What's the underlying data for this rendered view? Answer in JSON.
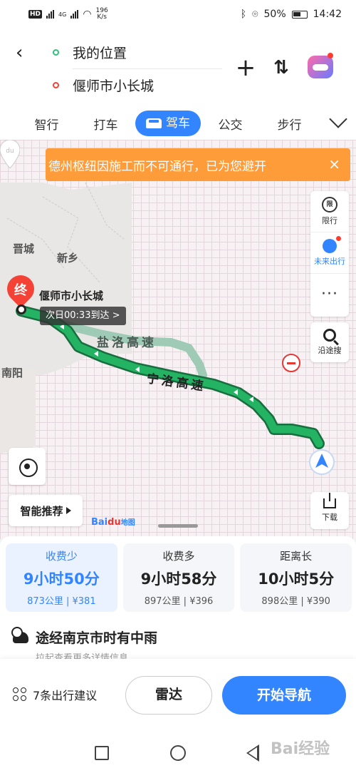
{
  "status_bar": {
    "hd_label": "HD",
    "network_label": "4G",
    "speed_value": "196",
    "speed_unit": "K/s",
    "battery": "50%",
    "time": "14:42"
  },
  "header": {
    "start_point": "我的位置",
    "end_point": "偃师市小长城"
  },
  "tabs": [
    {
      "label": "智行"
    },
    {
      "label": "打车"
    },
    {
      "label": "驾车",
      "active": true
    },
    {
      "label": "公交"
    },
    {
      "label": "步行"
    }
  ],
  "map": {
    "banner_text": "德州枢纽因施工而不可通行，已为您避开",
    "cities": {
      "jincheng": "晋城",
      "xinxiang": "新乡",
      "nanyang": "南阳"
    },
    "end_pin_label": "终",
    "destination_name": "偃师市小长城",
    "eta_text": "次日00:33到达 >",
    "road_alt": "盐洛高速",
    "road_main": "宁洛高速",
    "side_panel": {
      "restrict_icon_text": "限",
      "restrict_label": "限行",
      "future_label": "未来出行",
      "more_label": "···"
    },
    "search_along_label": "沿途搜",
    "smart_recommend_label": "智能推荐",
    "download_label": "下载",
    "logo_text_a": "Bai",
    "logo_text_b": "du",
    "logo_text_c": "地图"
  },
  "routes": [
    {
      "label": "收费少",
      "time": "9小时50分",
      "meta": "873公里 | ¥381",
      "selected": true
    },
    {
      "label": "收费多",
      "time": "9小时58分",
      "meta": "897公里 | ¥396",
      "selected": false
    },
    {
      "label": "距离长",
      "time": "10小时5分",
      "meta": "898公里 | ¥390",
      "selected": false
    }
  ],
  "weather": {
    "text": "途经南京市时有中雨",
    "more_info": "拉起查看更多详情信息"
  },
  "actions": {
    "tips_label": "7条出行建议",
    "radar_label": "雷达",
    "navigate_label": "开始导航"
  },
  "watermark": "Bai经验",
  "colors": {
    "accent": "#3385ff",
    "route_green": "#1f9e5b",
    "banner_orange": "#ff9c3a",
    "destination_red": "#f44336"
  }
}
